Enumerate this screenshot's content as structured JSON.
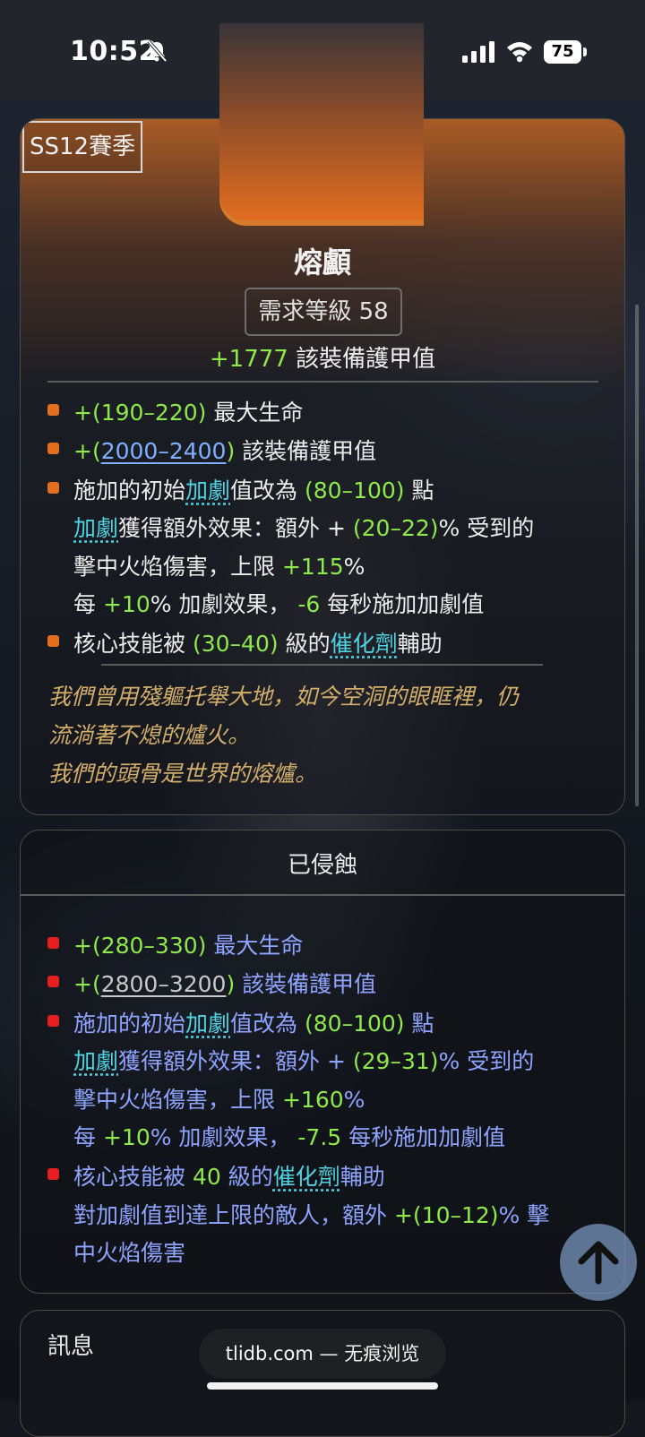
{
  "status_bar": {
    "time": "10:52",
    "battery": "75",
    "icons": [
      "bell-slash-icon",
      "cellular-signal-icon",
      "wifi-icon",
      "battery-icon"
    ]
  },
  "item": {
    "season_tag": "SS12賽季",
    "name": "熔顱",
    "requirement": "需求等級 58",
    "base_armor_value": "+1777",
    "base_armor_label": "該裝備護甲值",
    "mods": {
      "m1_val": "+(190–220)",
      "m1_text": "最大生命",
      "m2_prefix": "+(",
      "m2_range": "2000–2400",
      "m2_suffix": ")",
      "m2_text": "該裝備護甲值",
      "m3_a": "施加的初始",
      "m3_link": "加劇",
      "m3_b": "值改為",
      "m3_val": "(80–100)",
      "m3_c": "點",
      "m3_l2_link": "加劇",
      "m3_l2_a": "獲得額外效果：額外 +",
      "m3_l2_val": "(20–22)",
      "m3_l2_b": "% 受到的",
      "m3_l3_a": "擊中火焰傷害，上限",
      "m3_l3_val": "+115",
      "m3_l3_b": "%",
      "m3_l4_a": "每",
      "m3_l4_val": "+10",
      "m3_l4_b": "% 加劇效果，",
      "m3_l4_val2": "-6",
      "m3_l4_c": "每秒施加加劇值",
      "m4_a": "核心技能被",
      "m4_val": "(30–40)",
      "m4_b": "級的",
      "m4_link": "催化劑",
      "m4_c": "輔助"
    },
    "flavor": [
      "我們曾用殘軀托舉大地，如今空洞的眼眶裡，仍",
      "流淌著不熄的爐火。",
      "我們的頭骨是世界的熔爐。"
    ]
  },
  "corroded": {
    "title": "已侵蝕",
    "m1_val": "+(280–330)",
    "m1_text": "最大生命",
    "m2_prefix": "+(",
    "m2_range": "2800–3200",
    "m2_suffix": ")",
    "m2_text": "該裝備護甲值",
    "m3_a": "施加的初始",
    "m3_link": "加劇",
    "m3_b": "值改為",
    "m3_val": "(80–100)",
    "m3_c": "點",
    "m3_l2_link": "加劇",
    "m3_l2_a": "獲得額外效果：額外 +",
    "m3_l2_val": "(29–31)",
    "m3_l2_b": "% 受到的",
    "m3_l3_a": "擊中火焰傷害，上限",
    "m3_l3_val": "+160",
    "m3_l3_b": "%",
    "m3_l4_a": "每",
    "m3_l4_val": "+10",
    "m3_l4_b": "% 加劇效果，",
    "m3_l4_val2": "-7.5",
    "m3_l4_c": "每秒施加加劇值",
    "m4_a": "核心技能被",
    "m4_val": "40",
    "m4_b": "級的",
    "m4_link": "催化劑",
    "m4_c": "輔助",
    "m4_l2_a": "對加劇值到達上限的敵人，額外",
    "m4_l2_val": "+(10–12)",
    "m4_l2_b": "% 擊",
    "m4_l3": "中火焰傷害"
  },
  "info": {
    "title": "訊息"
  },
  "browser": {
    "url_label": "tlidb.com — 无痕浏览"
  },
  "colors": {
    "accent_orange": "#e36f1e",
    "corroded_red": "#e51f1f",
    "value_green": "#8ee94a",
    "link_cyan": "#4fd4e4",
    "flavor_gold": "#d2ae6a",
    "corroded_text": "#8ea4ff"
  }
}
